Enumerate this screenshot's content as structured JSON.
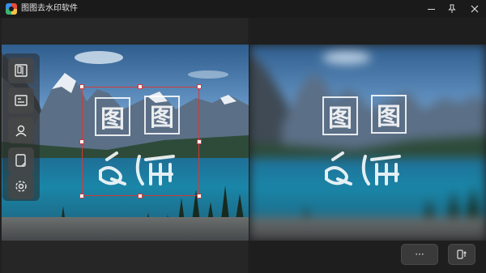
{
  "window": {
    "title": "图图去水印软件",
    "icons": {
      "app": "app-logo-icon",
      "minimize": "minimize-icon",
      "pin": "pin-icon",
      "close": "close-icon"
    }
  },
  "watermark": {
    "text_line1_a": "图",
    "text_line1_b": "图"
  },
  "toolbar": {
    "tools": [
      {
        "name": "open-image-tool",
        "icon": "image-book-icon"
      },
      {
        "name": "remove-watermark-tool",
        "icon": "frame-icon"
      },
      {
        "name": "portrait-tool",
        "icon": "person-icon"
      },
      {
        "name": "crop-tool",
        "icon": "crop-icon"
      },
      {
        "name": "settings-tool",
        "icon": "gear-icon"
      }
    ]
  },
  "bottom": {
    "more_label": "···",
    "export_icon": "export-icon"
  },
  "colors": {
    "selection": "#d23a3a",
    "titlebar": "#1a1a1a",
    "background": "#202020"
  }
}
